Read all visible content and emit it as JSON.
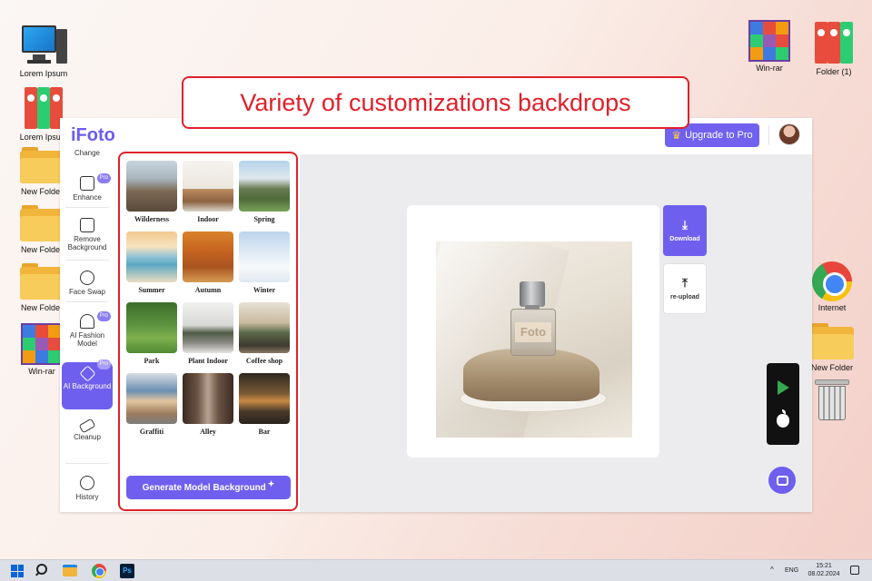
{
  "desktop": {
    "icons_left": [
      {
        "label": "Lorem Ipsum",
        "icon": "computer-icon"
      },
      {
        "label": "Lorem Ipsum",
        "icon": "binders-icon"
      },
      {
        "label": "New Folder",
        "icon": "folder-icon"
      },
      {
        "label": "New Folder",
        "icon": "folder-icon"
      },
      {
        "label": "New Folder",
        "icon": "folder-icon"
      },
      {
        "label": "Win-rar",
        "icon": "winrar-icon"
      }
    ],
    "icons_right": [
      {
        "label": "Win-rar",
        "icon": "winrar-icon"
      },
      {
        "label": "Folder (1)",
        "icon": "binders-icon"
      },
      {
        "label": "Internet",
        "icon": "chrome-icon"
      },
      {
        "label": "New Folder",
        "icon": "folder-icon"
      },
      {
        "label": "",
        "icon": "recycle-bin-icon"
      }
    ]
  },
  "callout": {
    "text": "Variety of customizations backdrops",
    "color": "#e0202a"
  },
  "app": {
    "logo": "iFoto",
    "upgrade_label": "Upgrade to Pro",
    "accent_color": "#6f5fee",
    "sidebar": [
      {
        "label": "Change",
        "icon": "change-icon",
        "pro": false
      },
      {
        "label": "Enhance",
        "icon": "enhance-icon",
        "pro": true
      },
      {
        "label": "Remove Background",
        "icon": "remove-background-icon",
        "pro": false
      },
      {
        "label": "Face Swap",
        "icon": "face-swap-icon",
        "pro": false
      },
      {
        "label": "AI Fashion Model",
        "icon": "fashion-model-icon",
        "pro": true
      },
      {
        "label": "AI Background",
        "icon": "ai-background-icon",
        "pro": true,
        "active": true
      },
      {
        "label": "Cleanup",
        "icon": "eraser-icon",
        "pro": false
      },
      {
        "label": "History",
        "icon": "clock-icon",
        "pro": false
      }
    ],
    "pro_badge": "Pro",
    "backgrounds": [
      {
        "label": "Wilderness"
      },
      {
        "label": "Indoor"
      },
      {
        "label": "Spring"
      },
      {
        "label": "Summer"
      },
      {
        "label": "Autumn"
      },
      {
        "label": "Winter"
      },
      {
        "label": "Park"
      },
      {
        "label": "Plant Indoor"
      },
      {
        "label": "Coffee shop"
      },
      {
        "label": "Graffiti"
      },
      {
        "label": "Alley"
      },
      {
        "label": "Bar"
      }
    ],
    "generate_label": "Generate Model Background",
    "bottle_text": "Foto",
    "download_label": "Download",
    "reupload_label": "re-upload"
  },
  "taskbar": {
    "lang": "ENG",
    "time": "15:21",
    "date": "08.02.2024",
    "tray_arrow": "^"
  }
}
